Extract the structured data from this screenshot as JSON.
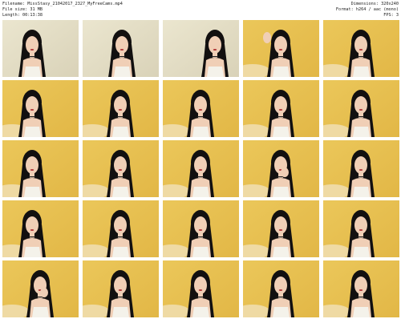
{
  "header": {
    "left": [
      "Filename: MissStasy_21042017_2327_MyFreeCams.mp4",
      "File size: 31 MB",
      "Length: 00:13:38"
    ],
    "right": [
      "Dimensions: 320x240",
      "Format: h264 / aac (mono)",
      "FPS: 3"
    ]
  },
  "grid": {
    "rows": 5,
    "cols": 5,
    "frames": [
      {
        "scene": "white-room",
        "pose": "leaning-left"
      },
      {
        "scene": "white-room",
        "pose": "leaning-center"
      },
      {
        "scene": "white-room",
        "pose": "close-partial"
      },
      {
        "scene": "yellow-room",
        "pose": "hand-up"
      },
      {
        "scene": "yellow-room",
        "pose": "center"
      },
      {
        "scene": "yellow-room",
        "pose": "left"
      },
      {
        "scene": "yellow-room",
        "pose": "center"
      },
      {
        "scene": "yellow-room",
        "pose": "center"
      },
      {
        "scene": "yellow-room",
        "pose": "center"
      },
      {
        "scene": "yellow-room",
        "pose": "center"
      },
      {
        "scene": "yellow-room",
        "pose": "left"
      },
      {
        "scene": "yellow-room",
        "pose": "center"
      },
      {
        "scene": "yellow-room",
        "pose": "center"
      },
      {
        "scene": "yellow-room",
        "pose": "hand-face"
      },
      {
        "scene": "yellow-room",
        "pose": "center"
      },
      {
        "scene": "yellow-room",
        "pose": "left"
      },
      {
        "scene": "yellow-room",
        "pose": "center"
      },
      {
        "scene": "yellow-room",
        "pose": "center"
      },
      {
        "scene": "yellow-room",
        "pose": "center"
      },
      {
        "scene": "yellow-room",
        "pose": "center"
      },
      {
        "scene": "yellow-room",
        "pose": "hand-face"
      },
      {
        "scene": "yellow-room",
        "pose": "center"
      },
      {
        "scene": "yellow-room",
        "pose": "center"
      },
      {
        "scene": "yellow-room",
        "pose": "center"
      },
      {
        "scene": "yellow-room",
        "pose": "center"
      }
    ]
  },
  "colors": {
    "white_room_bg": "#ebe6cf",
    "yellow_room_bg": "#ebc75a",
    "hair": "#121010",
    "skin": "#f0cfb6",
    "top": "#f4f2ea"
  },
  "watermark": ""
}
